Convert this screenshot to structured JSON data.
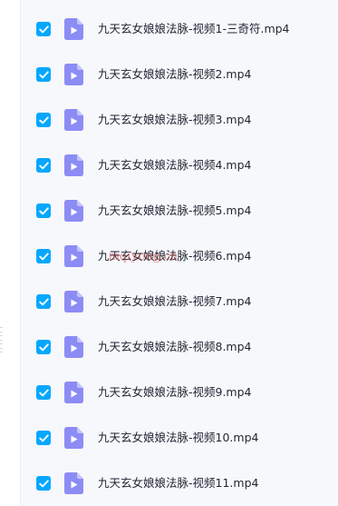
{
  "colors": {
    "checkbox": "#06a7ff",
    "file_icon": "#8c8cf5",
    "file_icon_fold": "#c3c3fb",
    "list_background": "#f7f8fb",
    "text": "#1f2533",
    "watermark": "#e53a3a"
  },
  "file_icon_name": "video-file-icon",
  "checkbox_icon_name": "checkmark-icon",
  "files": [
    {
      "name": "九天玄女娘娘法脉-视频1-三奇符.mp4",
      "checked": true
    },
    {
      "name": "九天玄女娘娘法脉-视频2.mp4",
      "checked": true
    },
    {
      "name": "九天玄女娘娘法脉-视频3.mp4",
      "checked": true
    },
    {
      "name": "九天玄女娘娘法脉-视频4.mp4",
      "checked": true
    },
    {
      "name": "九天玄女娘娘法脉-视频5.mp4",
      "checked": true
    },
    {
      "name": "九天玄女娘娘法脉-视频6.mp4",
      "checked": true
    },
    {
      "name": "九天玄女娘娘法脉-视频7.mp4",
      "checked": true
    },
    {
      "name": "九天玄女娘娘法脉-视频8.mp4",
      "checked": true
    },
    {
      "name": "九天玄女娘娘法脉-视频9.mp4",
      "checked": true
    },
    {
      "name": "九天玄女娘娘法脉-视频10.mp4",
      "checked": true
    },
    {
      "name": "九天玄女娘娘法脉-视频11.mp4",
      "checked": true
    }
  ],
  "watermark": "mqiyong.cn"
}
